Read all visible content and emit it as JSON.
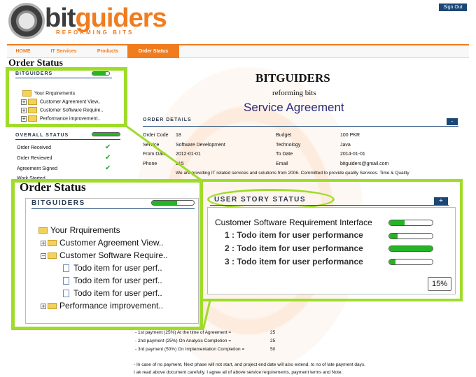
{
  "header": {
    "logo_main": "bit",
    "logo_accent": "guiders",
    "logo_tagline": "REFORMING BITS",
    "signout_label": "Sign Out"
  },
  "nav": {
    "items": [
      "HOME",
      "IT Services",
      "Products",
      "Order Status"
    ],
    "active_index": 3
  },
  "page_title": "Order Status",
  "sidebar": {
    "bitguiders_title": "BITGUIDERS",
    "bitguiders_progress": 0.8,
    "tree": {
      "root": "Your Rrquirements",
      "items": [
        "Customer Agreement View..",
        "Customer Software Require..",
        "Performance improvement.."
      ]
    },
    "overall_title": "OVERALL STATUS",
    "overall_progress": 1.0,
    "statuses": [
      "Order Received",
      "Order Reviewed",
      "Agreement Signed",
      "Work Started"
    ]
  },
  "agreement": {
    "company": "BITGUIDERS",
    "tagline": "reforming bits",
    "title": "Service Agreement",
    "section_title": "ORDER DETAILS",
    "collapse_label": "-",
    "fields": {
      "order_code_label": "Order Code",
      "order_code": "18",
      "service_label": "Service",
      "service": "Software Development",
      "from_label": "From Date",
      "from": "2012-01-01",
      "phone_label": "Phone",
      "phone": "215",
      "budget_label": "Budget",
      "budget": "100 PKR",
      "technology_label": "Technology",
      "technology": "Java",
      "to_label": "To Date",
      "to": "2014-01-01",
      "email_label": "Email",
      "email": "bitguiders@gmail.com",
      "description": "We are providing IT related services and solutions from 2006. Committed to provide quality Services. Time & Quality"
    },
    "payments": [
      "- 1st payment (25%) At the time of Agreement =",
      "- 2nd payment (25%) On Analysis Completion =",
      "- 3rd payment (50%) On Implementation Completion ="
    ],
    "payment_values": [
      "25",
      "25",
      "50"
    ],
    "note1": "- In case of no payment, Next phase will not start, and project end date will also extend, to no of late payment days.",
    "note2": "I ak read above document carefully. I agree all of above service requirements, payment terms and Note."
  },
  "overlay": {
    "title": "Order Status",
    "subtitle": "BITGUIDERS",
    "progress": 0.6,
    "root": "Your Rrquirements",
    "item_agreement": "Customer Agreement View..",
    "item_software": "Customer Software Require..",
    "subitems": [
      "Todo item for user perf..",
      "Todo item for user perf..",
      "Todo item for user perf.."
    ],
    "item_performance": "Performance improvement.."
  },
  "user_story": {
    "title": "USER STORY STATUS",
    "add_label": "+",
    "header_row": "Customer Software Requirement Interface",
    "header_progress": 0.35,
    "rows": [
      {
        "label": "1 : Todo item for user performance",
        "progress": 0.2
      },
      {
        "label": "2 : Todo item for user performance",
        "progress": 1.0
      },
      {
        "label": "3 : Todo item for user performance",
        "progress": 0.15
      }
    ],
    "percent": "15%"
  },
  "colors": {
    "accent": "#f07c1e",
    "navy": "#1b4777",
    "progress_green": "#25b425",
    "highlight": "#9fdc2a"
  }
}
